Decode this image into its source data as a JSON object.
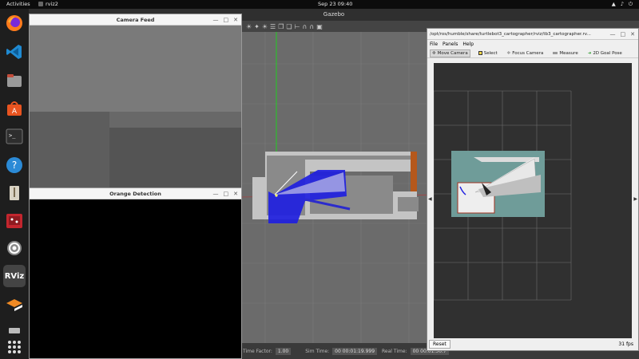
{
  "topbar": {
    "activities": "Activities",
    "app_name": "rviz2",
    "clock": "Sep 23  09:40"
  },
  "dock": {
    "items": [
      {
        "name": "firefox-icon"
      },
      {
        "name": "vscode-icon"
      },
      {
        "name": "files-icon"
      },
      {
        "name": "software-center-icon"
      },
      {
        "name": "terminal-icon",
        "glyph": ">_"
      },
      {
        "name": "help-icon",
        "glyph": "?"
      },
      {
        "name": "text-editor-icon"
      },
      {
        "name": "image-viewer-icon"
      },
      {
        "name": "settings-icon"
      },
      {
        "name": "rviz-icon",
        "glyph": "RViz"
      },
      {
        "name": "gazebo-icon"
      },
      {
        "name": "drive-icon"
      },
      {
        "name": "app-grid-icon"
      }
    ]
  },
  "gazebo": {
    "title": "Gazebo",
    "status": {
      "time_factor_label": "Time Factor:",
      "time_factor_value": "1.00",
      "sim_time_label": "Sim Time:",
      "sim_time_value": "00 00:01:19.999",
      "real_time_label": "Real Time:",
      "real_time_value": "00 00:01:50.7"
    }
  },
  "camera_window": {
    "title": "Camera Feed"
  },
  "orange_window": {
    "title": "Orange Detection"
  },
  "rviz": {
    "title": "/opt/ros/humble/share/turtlebot3_cartographer/rviz/tb3_cartographer.rv...",
    "menu": [
      "File",
      "Panels",
      "Help"
    ],
    "tools": [
      {
        "label": "Move Camera",
        "active": true
      },
      {
        "label": "Select",
        "active": false
      },
      {
        "label": "Focus Camera",
        "active": false
      },
      {
        "label": "Measure",
        "active": false
      },
      {
        "label": "2D Goal Pose",
        "active": false
      }
    ],
    "reset_label": "Reset",
    "fps": "31 fps"
  },
  "colors": {
    "laser_blue": "#1f1fe0",
    "map_teal": "#6f9c99",
    "wall_orange": "#c8641e",
    "lidar_green": "#22cc22"
  }
}
